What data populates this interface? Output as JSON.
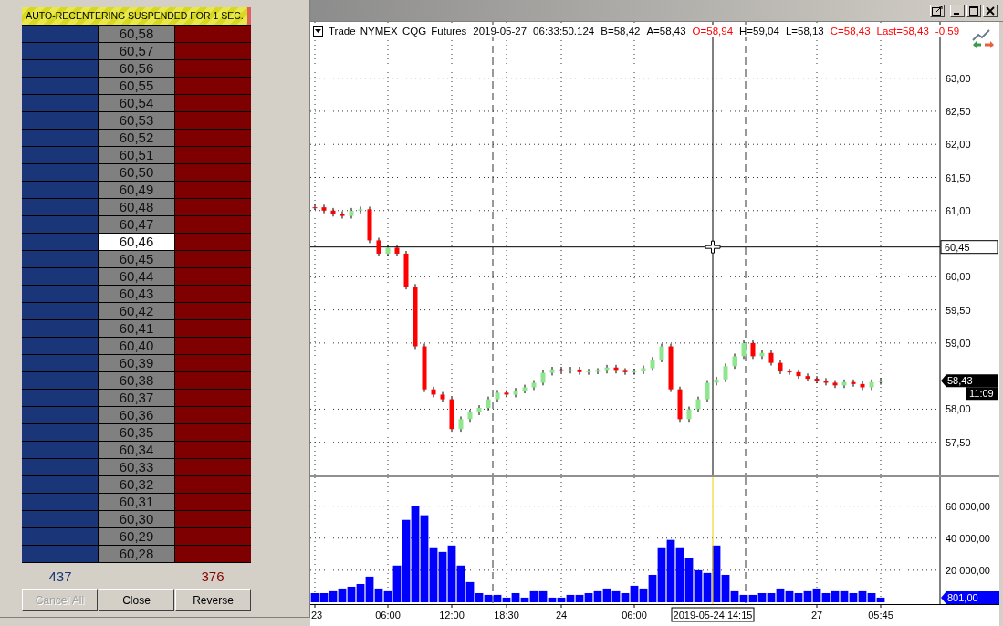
{
  "dom_ladder": {
    "banner": "AUTO-RECENTERING SUSPENDED FOR 1 SEC.",
    "rows": [
      {
        "price": "60,58",
        "selected": false
      },
      {
        "price": "60,57",
        "selected": false
      },
      {
        "price": "60,56",
        "selected": false
      },
      {
        "price": "60,55",
        "selected": false
      },
      {
        "price": "60,54",
        "selected": false
      },
      {
        "price": "60,53",
        "selected": false
      },
      {
        "price": "60,52",
        "selected": false
      },
      {
        "price": "60,51",
        "selected": false
      },
      {
        "price": "60,50",
        "selected": false
      },
      {
        "price": "60,49",
        "selected": false
      },
      {
        "price": "60,48",
        "selected": false
      },
      {
        "price": "60,47",
        "selected": false
      },
      {
        "price": "60,46",
        "selected": true
      },
      {
        "price": "60,45",
        "selected": false
      },
      {
        "price": "60,44",
        "selected": false
      },
      {
        "price": "60,43",
        "selected": false
      },
      {
        "price": "60,42",
        "selected": false
      },
      {
        "price": "60,41",
        "selected": false
      },
      {
        "price": "60,40",
        "selected": false
      },
      {
        "price": "60,39",
        "selected": false
      },
      {
        "price": "60,38",
        "selected": false
      },
      {
        "price": "60,37",
        "selected": false
      },
      {
        "price": "60,36",
        "selected": false
      },
      {
        "price": "60,35",
        "selected": false
      },
      {
        "price": "60,34",
        "selected": false
      },
      {
        "price": "60,33",
        "selected": false
      },
      {
        "price": "60,32",
        "selected": false
      },
      {
        "price": "60,31",
        "selected": false
      },
      {
        "price": "60,30",
        "selected": false
      },
      {
        "price": "60,29",
        "selected": false
      },
      {
        "price": "60,28",
        "selected": false
      }
    ],
    "bid_total": "437",
    "ask_total": "376",
    "buttons": [
      {
        "label": "Cancel All",
        "disabled": true
      },
      {
        "label": "Close",
        "disabled": false
      },
      {
        "label": "Reverse",
        "disabled": false
      }
    ]
  },
  "chart": {
    "legend": [
      {
        "text": "Trade NYMEX CQG Futures",
        "color": "#000000"
      },
      {
        "text": "2019-05-27",
        "color": "#000000"
      },
      {
        "text": "06:33:50.124",
        "color": "#000000"
      },
      {
        "text": "B=58,42",
        "color": "#000000"
      },
      {
        "text": "A=58,43",
        "color": "#000000"
      },
      {
        "text": "O=58,94",
        "color": "#ff0000"
      },
      {
        "text": "H=59,04",
        "color": "#000000"
      },
      {
        "text": "L=58,13",
        "color": "#000000"
      },
      {
        "text": "C=58,43",
        "color": "#ff0000"
      },
      {
        "text": "Last=58,43",
        "color": "#ff0000"
      },
      {
        "text": "-0,59",
        "color": "#ff0000"
      }
    ],
    "price_pane": {
      "last_label": "58,43",
      "timer": "11:09",
      "chart_data": {
        "type": "candlestick",
        "grid": true,
        "ylim": [
          57.0,
          63.85
        ],
        "categories": [
          null,
          null,
          null,
          null,
          null,
          null,
          null,
          null,
          null,
          null,
          null,
          null,
          null,
          null,
          null,
          null,
          null,
          null,
          null,
          null,
          null,
          null,
          null,
          null,
          null,
          null,
          null,
          null,
          null,
          null,
          null,
          null,
          null,
          null,
          null,
          null,
          null,
          null,
          null,
          null,
          null,
          null,
          null,
          null,
          null,
          null,
          null,
          null,
          null,
          null,
          null,
          null,
          null,
          null,
          null,
          null,
          null,
          null,
          null,
          null,
          null,
          null,
          null,
          null,
          null,
          null,
          null,
          null,
          null
        ],
        "ohlc": [
          [
            61.05,
            61.09,
            61.01,
            61.05
          ],
          [
            61.05,
            61.09,
            60.96,
            61.0
          ],
          [
            61.0,
            61.04,
            60.91,
            60.95
          ],
          [
            60.95,
            60.99,
            60.88,
            60.92
          ],
          [
            60.92,
            61.04,
            60.88,
            61.0
          ],
          [
            61.0,
            61.06,
            60.96,
            61.02
          ],
          [
            61.02,
            61.06,
            60.51,
            60.55
          ],
          [
            60.55,
            60.59,
            60.31,
            60.35
          ],
          [
            60.35,
            60.48,
            60.31,
            60.44
          ],
          [
            60.44,
            60.48,
            60.31,
            60.35
          ],
          [
            60.35,
            60.39,
            59.81,
            59.85
          ],
          [
            59.85,
            59.89,
            58.91,
            58.95
          ],
          [
            58.95,
            58.99,
            58.26,
            58.3
          ],
          [
            58.3,
            58.34,
            58.18,
            58.22
          ],
          [
            58.22,
            58.26,
            58.11,
            58.15
          ],
          [
            58.15,
            58.19,
            57.66,
            57.7
          ],
          [
            57.7,
            57.89,
            57.66,
            57.85
          ],
          [
            57.85,
            57.99,
            57.81,
            57.95
          ],
          [
            57.95,
            58.06,
            57.91,
            58.02
          ],
          [
            58.02,
            58.19,
            57.98,
            58.15
          ],
          [
            58.15,
            58.29,
            58.11,
            58.25
          ],
          [
            58.25,
            58.29,
            58.18,
            58.22
          ],
          [
            58.22,
            58.32,
            58.18,
            58.28
          ],
          [
            58.28,
            58.37,
            58.24,
            58.33
          ],
          [
            58.33,
            58.44,
            58.29,
            58.4
          ],
          [
            58.4,
            58.59,
            58.36,
            58.55
          ],
          [
            58.55,
            58.64,
            58.51,
            58.6
          ],
          [
            58.6,
            58.64,
            58.54,
            58.58
          ],
          [
            58.58,
            58.64,
            58.54,
            58.6
          ],
          [
            58.6,
            58.64,
            58.52,
            58.56
          ],
          [
            58.56,
            58.61,
            58.52,
            58.57
          ],
          [
            58.57,
            58.62,
            58.53,
            58.58
          ],
          [
            58.58,
            58.67,
            58.54,
            58.63
          ],
          [
            58.63,
            58.67,
            58.54,
            58.58
          ],
          [
            58.58,
            58.62,
            58.52,
            58.56
          ],
          [
            58.56,
            58.61,
            58.52,
            58.57
          ],
          [
            58.57,
            58.66,
            58.53,
            58.62
          ],
          [
            58.62,
            58.79,
            58.58,
            58.75
          ],
          [
            58.75,
            58.99,
            58.71,
            58.95
          ],
          [
            58.95,
            58.99,
            58.26,
            58.3
          ],
          [
            58.3,
            58.34,
            57.81,
            57.85
          ],
          [
            57.85,
            58.04,
            57.81,
            58.0
          ],
          [
            58.0,
            58.19,
            57.96,
            58.15
          ],
          [
            58.15,
            58.44,
            58.11,
            58.4
          ],
          [
            58.4,
            58.49,
            58.36,
            58.45
          ],
          [
            58.45,
            58.69,
            58.41,
            58.65
          ],
          [
            58.65,
            58.84,
            58.61,
            58.8
          ],
          [
            58.8,
            59.04,
            58.76,
            59.0
          ],
          [
            59.0,
            59.04,
            58.76,
            58.8
          ],
          [
            58.8,
            58.89,
            58.76,
            58.85
          ],
          [
            58.85,
            58.89,
            58.66,
            58.7
          ],
          [
            58.7,
            58.74,
            58.53,
            58.57
          ],
          [
            58.57,
            58.61,
            58.52,
            58.56
          ],
          [
            58.56,
            58.6,
            58.46,
            58.5
          ],
          [
            58.5,
            58.54,
            58.42,
            58.46
          ],
          [
            58.46,
            58.5,
            58.39,
            58.43
          ],
          [
            58.43,
            58.47,
            58.36,
            58.4
          ],
          [
            58.4,
            58.44,
            58.32,
            58.36
          ],
          [
            58.36,
            58.45,
            58.32,
            58.41
          ],
          [
            58.41,
            58.45,
            58.34,
            58.38
          ],
          [
            58.38,
            58.42,
            58.29,
            58.33
          ],
          [
            58.33,
            58.45,
            58.29,
            58.41
          ],
          [
            58.41,
            58.47,
            58.37,
            58.43
          ],
          null,
          null,
          null,
          null,
          null,
          null
        ],
        "yticks": [
          {
            "value": 57.5,
            "label": "57,50"
          },
          {
            "value": 58,
            "label": "58,00"
          },
          {
            "value": 59,
            "label": "59,00"
          },
          {
            "value": 59.5,
            "label": "59,50"
          },
          {
            "value": 60,
            "label": "60,00"
          },
          {
            "value": 61,
            "label": "61,00"
          },
          {
            "value": 61.5,
            "label": "61,50"
          },
          {
            "value": 62,
            "label": "62,00"
          },
          {
            "value": 62.5,
            "label": "62,50"
          },
          {
            "value": 63,
            "label": "63,00"
          }
        ],
        "ref_lines": [
          {
            "axis": "y",
            "value": 60.45,
            "label": "60,45"
          }
        ]
      }
    },
    "volume_pane": {
      "last_label": "801,00",
      "crosshair_time": "2019-05-24 14:15",
      "chart_data": {
        "type": "bar",
        "grid": true,
        "ylim": [
          0,
          78000
        ],
        "categories": [
          "23",
          null,
          null,
          null,
          null,
          null,
          null,
          null,
          "06:00",
          null,
          null,
          null,
          null,
          null,
          null,
          "12:00",
          null,
          null,
          null,
          null,
          null,
          "18:30",
          null,
          null,
          null,
          null,
          null,
          "24",
          null,
          null,
          null,
          null,
          null,
          null,
          null,
          "06:00",
          null,
          null,
          null,
          null,
          null,
          null,
          null,
          null,
          null,
          null,
          null,
          null,
          null,
          null,
          null,
          null,
          null,
          null,
          null,
          "27",
          null,
          null,
          null,
          null,
          null,
          null,
          "05:45",
          null,
          null,
          null,
          null,
          null,
          null
        ],
        "series": [
          {
            "color": "#0000ff",
            "values": [
              5700,
              5700,
              6900,
              8600,
              9700,
              11400,
              16000,
              8600,
              6900,
              22900,
              51400,
              60000,
              54300,
              34300,
              31400,
              35400,
              22900,
              12600,
              5700,
              4600,
              4600,
              2900,
              5700,
              2900,
              6900,
              6900,
              2900,
              2900,
              4600,
              4600,
              5700,
              6900,
              8600,
              6900,
              5700,
              10300,
              8600,
              17100,
              34300,
              38900,
              34300,
              27400,
              20000,
              18300,
              35400,
              17100,
              6900,
              4600,
              4600,
              5700,
              5700,
              8600,
              6900,
              5700,
              6900,
              8600,
              5700,
              6900,
              6900,
              5700,
              6900,
              5700,
              2900,
              null,
              null,
              null,
              null,
              null,
              null
            ]
          }
        ],
        "yticks": [
          {
            "value": 20000,
            "label": "20 000,00"
          },
          {
            "value": 40000,
            "label": "40 000,00"
          },
          {
            "value": 60000,
            "label": "60 000,00"
          }
        ]
      }
    }
  }
}
